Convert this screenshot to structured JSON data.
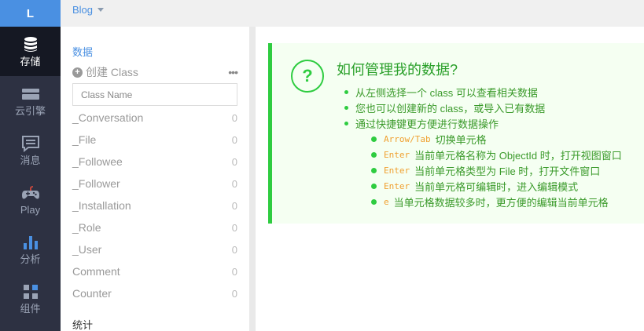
{
  "nav": {
    "logo": "L",
    "items": [
      {
        "label": "存储",
        "icon": "database-icon",
        "active": true
      },
      {
        "label": "云引擎",
        "icon": "engine-icon"
      },
      {
        "label": "消息",
        "icon": "message-icon"
      },
      {
        "label": "Play",
        "icon": "gamepad-icon"
      },
      {
        "label": "分析",
        "icon": "bar-chart-icon"
      },
      {
        "label": "组件",
        "icon": "components-icon"
      }
    ]
  },
  "topbar": {
    "app_name": "Blog"
  },
  "sidebar": {
    "section_data": "数据",
    "create_label": "创建 Class",
    "more": "•••",
    "search_placeholder": "Class Name",
    "classes": [
      {
        "name": "_Conversation",
        "count": "0"
      },
      {
        "name": "_File",
        "count": "0"
      },
      {
        "name": "_Followee",
        "count": "0"
      },
      {
        "name": "_Follower",
        "count": "0"
      },
      {
        "name": "_Installation",
        "count": "0"
      },
      {
        "name": "_Role",
        "count": "0"
      },
      {
        "name": "_User",
        "count": "0"
      },
      {
        "name": "Comment",
        "count": "0"
      },
      {
        "name": "Counter",
        "count": "0"
      }
    ],
    "section_stats": "统计"
  },
  "help": {
    "icon": "?",
    "title": "如何管理我的数据?",
    "items": [
      "从左侧选择一个 class 可以查看相关数据",
      "您也可以创建新的 class，或导入已有数据",
      "通过快捷键更方便进行数据操作"
    ],
    "shortcuts": [
      {
        "key": "Arrow/Tab",
        "desc": "切换单元格"
      },
      {
        "key": "Enter",
        "desc": "当前单元格名称为 ObjectId 时，打开视图窗口"
      },
      {
        "key": "Enter",
        "desc": "当前单元格类型为 File 时，打开文件窗口"
      },
      {
        "key": "Enter",
        "desc": "当前单元格可编辑时，进入编辑模式"
      },
      {
        "key": "e",
        "desc": "当单元格数据较多时，更方便的编辑当前单元格"
      }
    ]
  }
}
